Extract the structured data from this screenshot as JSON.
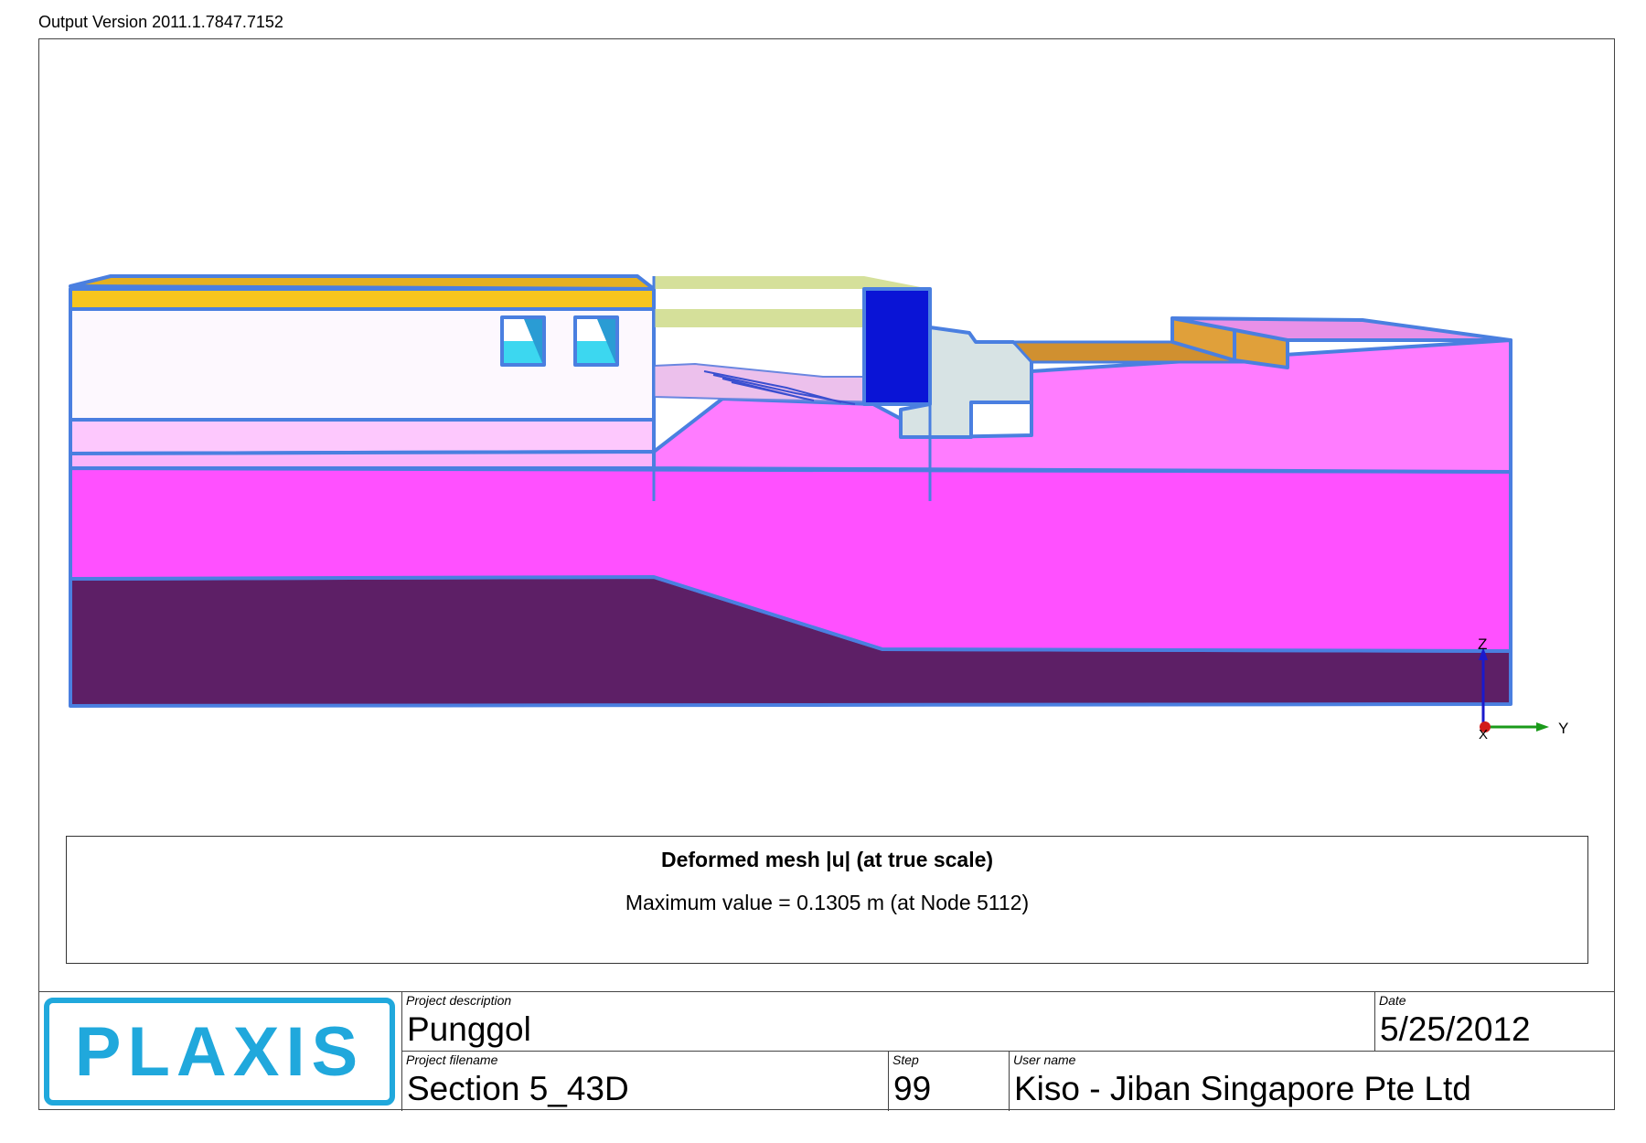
{
  "header": {
    "output_version": "Output Version 2011.1.7847.7152"
  },
  "axes": {
    "z_label": "Z",
    "y_label": "Y",
    "x_label": "X"
  },
  "legend": {
    "title": "Deformed mesh |u| (at true scale)",
    "max_value_text": "Maximum value = 0.1305 m (at Node 5112)"
  },
  "title_block": {
    "logo_text": "PLAXIS",
    "project_description": {
      "label": "Project description",
      "value": "Punggol"
    },
    "date": {
      "label": "Date",
      "value": "5/25/2012"
    },
    "project_filename": {
      "label": "Project filename",
      "value": "Section 5_43D"
    },
    "step": {
      "label": "Step",
      "value": "99"
    },
    "user_name": {
      "label": "User name",
      "value": "Kiso - Jiban Singapore Pte Ltd"
    }
  },
  "colors": {
    "outline": "#4a7fe0",
    "building_roof": "#f7c51e",
    "building_body": "#fdf8fe",
    "window_cyan": "#3cd7f0",
    "fill_top": "#fdc8fd",
    "soil_upper": "#ff7cff",
    "soil_mid": "#ff50ff",
    "soil_bottom": "#5d1f66",
    "sheet_pile": "#0a14d6",
    "concrete": "#d7e3e4",
    "slab": "#d5e09a",
    "timber": "#e0a03a",
    "logo": "#20a8dc"
  }
}
